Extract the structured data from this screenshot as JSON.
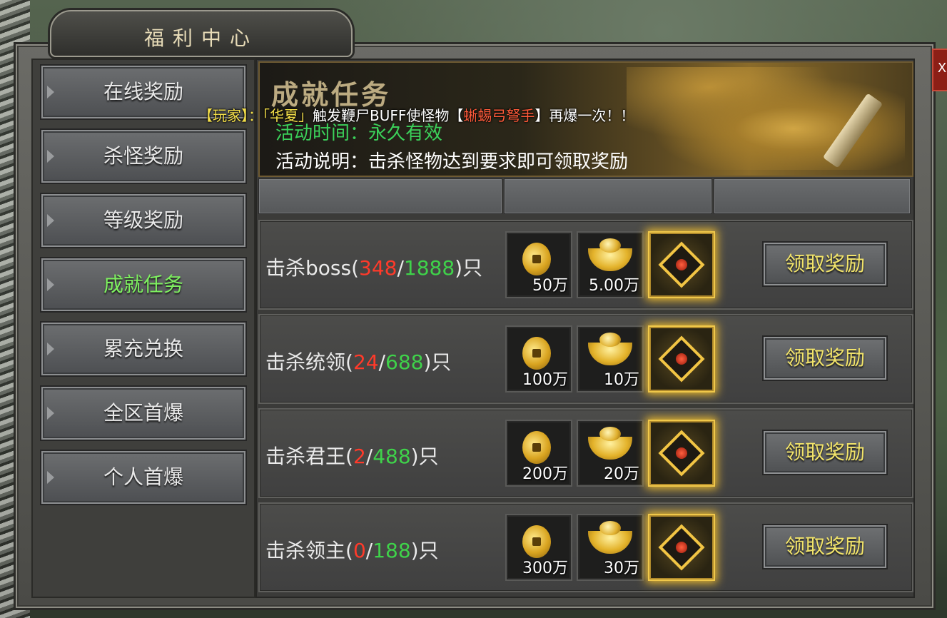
{
  "window": {
    "title": "福利中心",
    "close_label": "X"
  },
  "sidebar": {
    "items": [
      {
        "label": "在线奖励",
        "active": false
      },
      {
        "label": "杀怪奖励",
        "active": false
      },
      {
        "label": "等级奖励",
        "active": false
      },
      {
        "label": "成就任务",
        "active": true
      },
      {
        "label": "累充兑换",
        "active": false
      },
      {
        "label": "全区首爆",
        "active": false
      },
      {
        "label": "个人首爆",
        "active": false
      }
    ]
  },
  "banner": {
    "title": "成就任务",
    "time_label": "活动时间：永久有效",
    "desc_label": "活动说明：击杀怪物达到要求即可领取奖励"
  },
  "broadcast": {
    "p1": "【玩家】：",
    "p2": "「华夏」",
    "p3": "触发鞭尸BUFF使怪物",
    "p4": "【",
    "p5": "蜥蜴弓弩手",
    "p6": "】",
    "p7": "再爆一次！！"
  },
  "tasks": [
    {
      "prefix": "击杀boss(",
      "current": "348",
      "sep": "/",
      "total": "1888",
      "suffix": ")只",
      "rewards": [
        "50万",
        "5.00万"
      ],
      "claim_label": "领取奖励"
    },
    {
      "prefix": "击杀统领(",
      "current": "24",
      "sep": "/",
      "total": "688",
      "suffix": ")只",
      "rewards": [
        "100万",
        "10万"
      ],
      "claim_label": "领取奖励"
    },
    {
      "prefix": "击杀君王(",
      "current": "2",
      "sep": "/",
      "total": "488",
      "suffix": ")只",
      "rewards": [
        "200万",
        "20万"
      ],
      "claim_label": "领取奖励"
    },
    {
      "prefix": "击杀领主(",
      "current": "0",
      "sep": "/",
      "total": "188",
      "suffix": ")只",
      "rewards": [
        "300万",
        "30万"
      ],
      "claim_label": "领取奖励"
    }
  ],
  "icons": {
    "reward1": "gold-coin-icon",
    "reward2": "gold-ingot-icon",
    "reward3": "emblem-icon"
  },
  "colors": {
    "active_nav": "#7ef060",
    "progress_current": "#ff3a2a",
    "progress_total": "#3fd24a",
    "claim_text": "#f2e46a"
  }
}
